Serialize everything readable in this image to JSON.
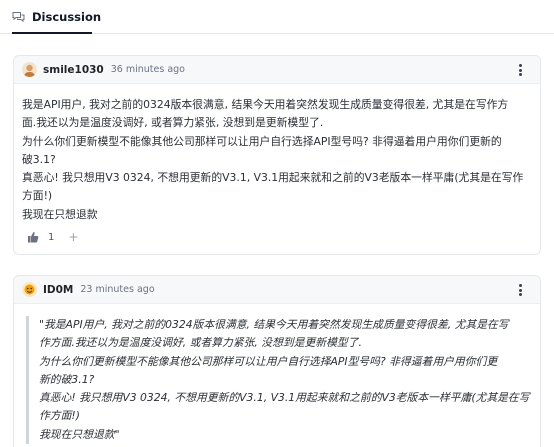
{
  "tab": {
    "label": "Discussion"
  },
  "comments": [
    {
      "author": "smile1030",
      "time": "36 minutes ago",
      "lines": [
        "我是API用户, 我对之前的0324版本很满意, 结果今天用着突然发现生成质量变得很差, 尤其是在写作方",
        "面.我还以为是温度没调好, 或者算力紧张, 没想到是更新模型了.",
        "为什么你们更新模型不能像其他公司那样可以让用户自行选择API型号吗? 非得逼着用户用你们更新的",
        "破3.1?",
        "真恶心! 我只想用V3 0324, 不想用更新的V3.1, V3.1用起来就和之前的V3老版本一样平庸(尤其是在写作",
        "方面!)",
        "我现在只想退款"
      ],
      "reaction_count": "1",
      "add_reaction": "+"
    },
    {
      "author": "ID0M",
      "time": "23 minutes ago",
      "lines": [
        "\"我是API用户, 我对之前的0324版本很满意, 结果今天用着突然发现生成质量变得很差, 尤其是在写",
        "作方面.我还以为是温度没调好, 或者算力紧张, 没想到是更新模型了.",
        "为什么你们更新模型不能像其他公司那样可以让用户自行选择API型号吗? 非得逼着用户用你们更",
        "新的破3.1?",
        "真恶心! 我只想用V3 0324, 不想用更新的V3.1, V3.1用起来就和之前的V3老版本一样平庸(尤其是在写",
        "作方面!)",
        "我现在只想退款\""
      ]
    }
  ]
}
